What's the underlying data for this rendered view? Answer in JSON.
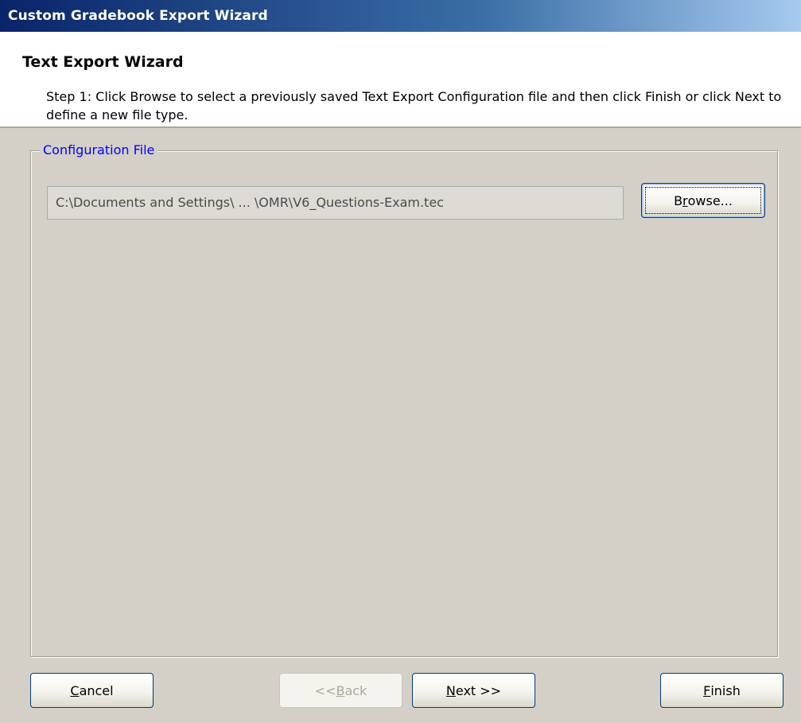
{
  "window": {
    "title": "Custom Gradebook Export Wizard"
  },
  "header": {
    "title": "Text Export Wizard",
    "description": "Step 1: Click Browse to select a previously saved Text Export Configuration file and then click Finish or click Next to define a new file type."
  },
  "config_group": {
    "legend": "Configuration File",
    "file_path": "C:\\Documents and Settings\\ ... \\OMR\\V6_Questions-Exam.tec",
    "browse_button": {
      "before": "B",
      "mnemonic": "r",
      "after": "owse...",
      "state": "focused"
    }
  },
  "footer": {
    "cancel_button": {
      "before": "",
      "mnemonic": "C",
      "after": "ancel",
      "state": "enabled"
    },
    "back_button": {
      "before": "<< ",
      "mnemonic": "B",
      "after": "ack",
      "state": "disabled"
    },
    "next_button": {
      "before": "",
      "mnemonic": "N",
      "after": "ext >>",
      "state": "enabled"
    },
    "finish_button": {
      "before": "",
      "mnemonic": "F",
      "after": "inish",
      "state": "enabled"
    }
  },
  "colors": {
    "title_bar_start": "#0a246a",
    "title_bar_end": "#a6caf0",
    "dialog_face": "#d4d0c8",
    "legend_text": "#0000ff",
    "button_border": "#003c74"
  }
}
